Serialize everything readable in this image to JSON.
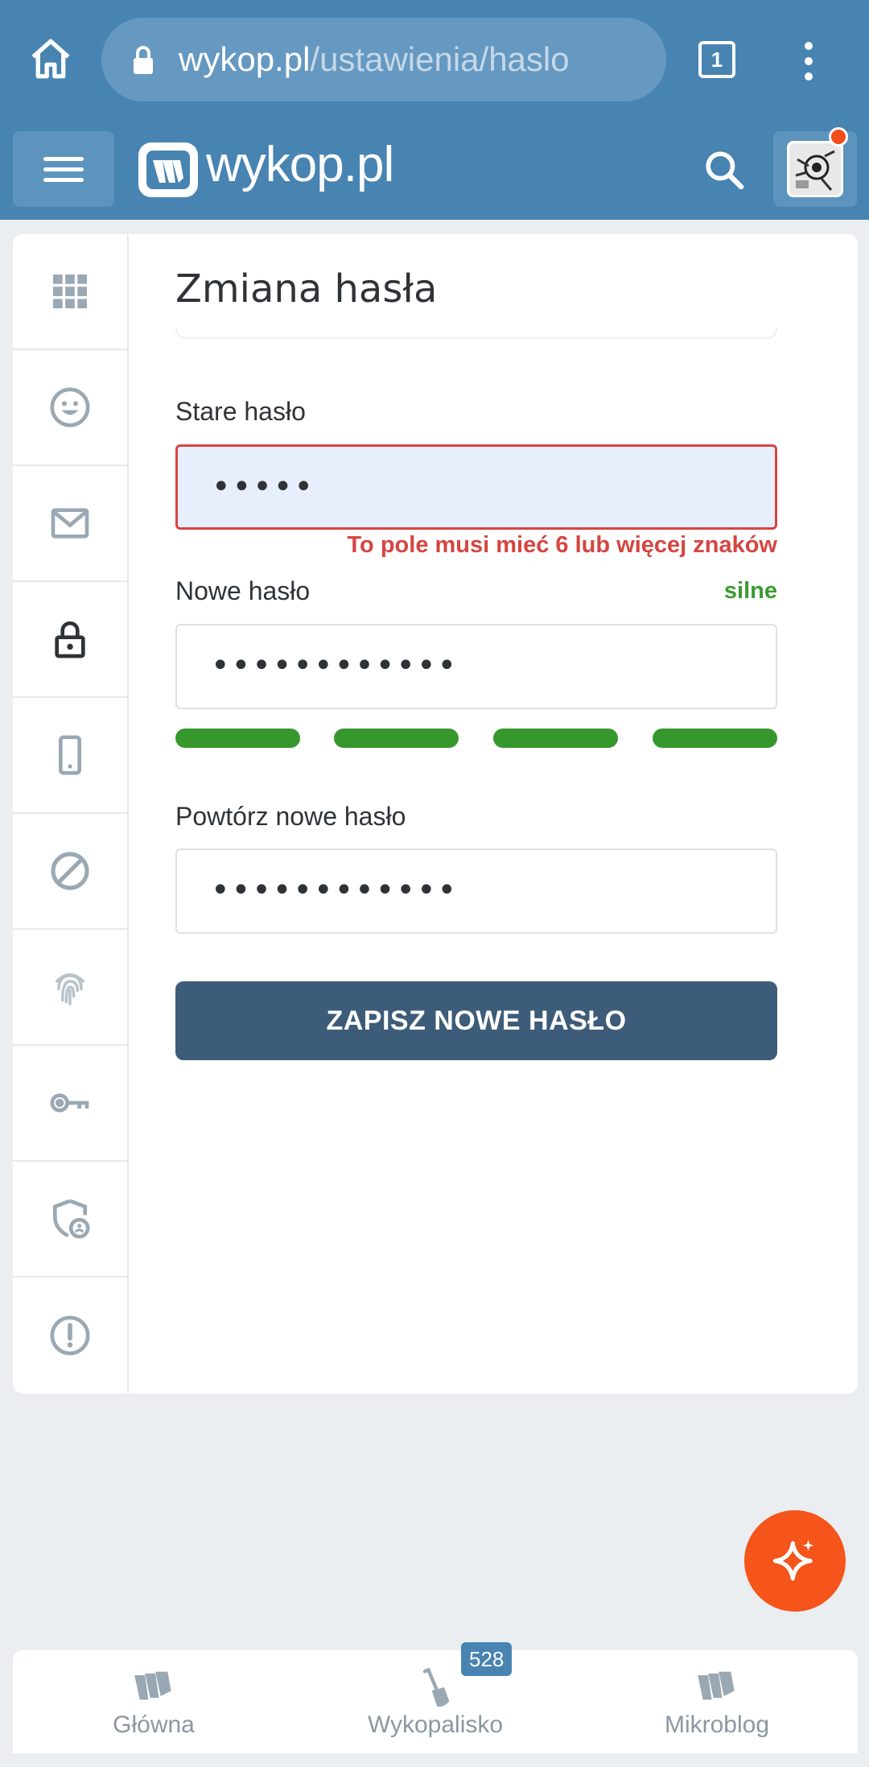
{
  "browser": {
    "url_domain": "wykop.pl",
    "url_path": "/ustawienia/haslo",
    "tab_count": "1"
  },
  "header": {
    "logo_text": "wykop.pl"
  },
  "sidebar": {
    "items": [
      {
        "icon": "grid-icon"
      },
      {
        "icon": "smiley-icon"
      },
      {
        "icon": "envelope-icon"
      },
      {
        "icon": "lock-icon",
        "active": true
      },
      {
        "icon": "phone-icon"
      },
      {
        "icon": "block-icon"
      },
      {
        "icon": "fingerprint-icon"
      },
      {
        "icon": "key-icon"
      },
      {
        "icon": "shield-user-icon"
      },
      {
        "icon": "alert-icon"
      }
    ]
  },
  "form": {
    "title": "Zmiana hasła",
    "old_password": {
      "label": "Stare hasło",
      "value": "•••••",
      "error": "To pole musi mieć 6 lub więcej znaków"
    },
    "new_password": {
      "label": "Nowe hasło",
      "value": "••••••••••••",
      "strength_label": "silne",
      "strength_level": 4,
      "strength_max": 4
    },
    "repeat_password": {
      "label": "Powtórz nowe hasło",
      "value": "••••••••••••"
    },
    "save_label": "ZAPISZ NOWE HASŁO"
  },
  "bottom_nav": {
    "items": [
      {
        "label": "Główna",
        "icon": "wykop-logo-icon"
      },
      {
        "label": "Wykopalisko",
        "icon": "shovel-icon",
        "badge": "528"
      },
      {
        "label": "Mikroblog",
        "icon": "mikroblog-icon"
      }
    ]
  },
  "colors": {
    "brand_blue": "#4884b2",
    "error_red": "#d64541",
    "strength_green": "#36972d",
    "button_dark": "#3d5c79",
    "fab_orange": "#f5541b"
  }
}
